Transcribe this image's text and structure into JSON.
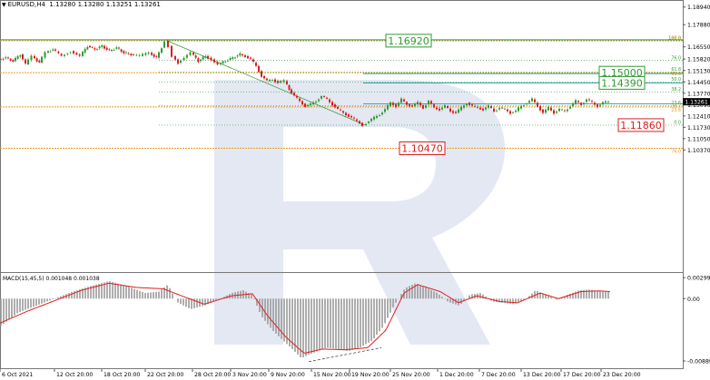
{
  "header": {
    "symbol_label": "EURUSD,H4",
    "ohlc": "1.13280 1.13280 1.13251 1.13261"
  },
  "chart_data": {
    "type": "candlestick",
    "symbol": "EURUSD",
    "timeframe": "H4",
    "price_axis": {
      "ylim": [
        1.0305,
        1.1925
      ],
      "ticks": [
        1.1894,
        1.1788,
        1.1655,
        1.1582,
        1.1513,
        1.1445,
        1.1377,
        1.1309,
        1.1241,
        1.1173,
        1.1105,
        1.1037
      ]
    },
    "current_price": "1.13261",
    "time_axis_labels": [
      "6 Oct 2021",
      "12 Oct 20:00",
      "18 Oct 20:00",
      "22 Oct 20:00",
      "28 Oct 20:00",
      "3 Nov 20:00",
      "9 Nov 20:00",
      "15 Nov 20:00",
      "19 Nov 20:00",
      "25 Nov 20:00",
      "1 Dec 20:00",
      "7 Dec 20:00",
      "13 Dec 20:00",
      "17 Dec 20:00",
      "23 Dec 20:00"
    ],
    "price_path": [
      [
        0,
        1.158
      ],
      [
        8,
        1.159
      ],
      [
        16,
        1.157
      ],
      [
        24,
        1.161
      ],
      [
        30,
        1.155
      ],
      [
        37,
        1.16
      ],
      [
        45,
        1.156
      ],
      [
        52,
        1.162
      ],
      [
        60,
        1.164
      ],
      [
        70,
        1.16
      ],
      [
        80,
        1.163
      ],
      [
        90,
        1.16
      ],
      [
        98,
        1.166
      ],
      [
        106,
        1.164
      ],
      [
        114,
        1.166
      ],
      [
        122,
        1.163
      ],
      [
        130,
        1.165
      ],
      [
        138,
        1.162
      ],
      [
        146,
        1.161
      ],
      [
        156,
        1.16
      ],
      [
        166,
        1.162
      ],
      [
        174,
        1.159
      ],
      [
        180,
        1.165
      ],
      [
        184,
        1.1692
      ],
      [
        188,
        1.166
      ],
      [
        192,
        1.16
      ],
      [
        198,
        1.156
      ],
      [
        205,
        1.159
      ],
      [
        212,
        1.162
      ],
      [
        220,
        1.157
      ],
      [
        228,
        1.16
      ],
      [
        235,
        1.158
      ],
      [
        242,
        1.155
      ],
      [
        250,
        1.157
      ],
      [
        258,
        1.159
      ],
      [
        266,
        1.161
      ],
      [
        272,
        1.16
      ],
      [
        278,
        1.158
      ],
      [
        284,
        1.154
      ],
      [
        290,
        1.148
      ],
      [
        296,
        1.145
      ],
      [
        302,
        1.146
      ],
      [
        308,
        1.144
      ],
      [
        315,
        1.145
      ],
      [
        320,
        1.14
      ],
      [
        326,
        1.136
      ],
      [
        332,
        1.133
      ],
      [
        338,
        1.13
      ],
      [
        344,
        1.131
      ],
      [
        350,
        1.133
      ],
      [
        356,
        1.136
      ],
      [
        362,
        1.134
      ],
      [
        368,
        1.131
      ],
      [
        374,
        1.128
      ],
      [
        380,
        1.126
      ],
      [
        386,
        1.124
      ],
      [
        392,
        1.122
      ],
      [
        398,
        1.12
      ],
      [
        402,
        1.1186
      ],
      [
        408,
        1.121
      ],
      [
        414,
        1.123
      ],
      [
        420,
        1.125
      ],
      [
        426,
        1.128
      ],
      [
        432,
        1.132
      ],
      [
        438,
        1.13
      ],
      [
        444,
        1.134
      ],
      [
        450,
        1.131
      ],
      [
        456,
        1.13
      ],
      [
        462,
        1.132
      ],
      [
        468,
        1.129
      ],
      [
        474,
        1.133
      ],
      [
        480,
        1.129
      ],
      [
        486,
        1.128
      ],
      [
        492,
        1.13
      ],
      [
        498,
        1.127
      ],
      [
        504,
        1.126
      ],
      [
        510,
        1.129
      ],
      [
        516,
        1.132
      ],
      [
        522,
        1.13
      ],
      [
        528,
        1.129
      ],
      [
        534,
        1.128
      ],
      [
        540,
        1.13
      ],
      [
        546,
        1.127
      ],
      [
        552,
        1.129
      ],
      [
        558,
        1.128
      ],
      [
        564,
        1.126
      ],
      [
        570,
        1.127
      ],
      [
        576,
        1.13
      ],
      [
        582,
        1.132
      ],
      [
        588,
        1.134
      ],
      [
        594,
        1.13
      ],
      [
        600,
        1.126
      ],
      [
        606,
        1.129
      ],
      [
        612,
        1.126
      ],
      [
        618,
        1.128
      ],
      [
        624,
        1.127
      ],
      [
        630,
        1.13
      ],
      [
        636,
        1.133
      ],
      [
        642,
        1.131
      ],
      [
        648,
        1.134
      ],
      [
        654,
        1.132
      ],
      [
        660,
        1.13
      ],
      [
        666,
        1.132
      ],
      [
        672,
        1.1326
      ]
    ],
    "horizontal_levels": [
      {
        "price": 1.1692,
        "color": "#e69c24"
      },
      {
        "price": 1.15,
        "color": "#e69c24"
      },
      {
        "price": 1.1295,
        "color": "#e69c24"
      },
      {
        "price": 1.1047,
        "color": "#e69c24"
      }
    ],
    "price_labels": [
      {
        "text": "1.16920",
        "price": 1.1692,
        "style": "green"
      },
      {
        "text": "1.15000",
        "price": 1.15,
        "style": "green"
      },
      {
        "text": "1.14390",
        "price": 1.1439,
        "style": "green"
      },
      {
        "text": "1.11860",
        "price": 1.1186,
        "style": "red"
      },
      {
        "text": "1.10470",
        "price": 1.1047,
        "style": "red"
      }
    ],
    "fib_retracement": {
      "levels": [
        {
          "label": "100.0",
          "price": 1.1692
        },
        {
          "label": "76.0",
          "price": 1.1573
        },
        {
          "label": "61.8",
          "price": 1.1504
        },
        {
          "label": "50.0",
          "price": 1.1443
        },
        {
          "label": "38.2",
          "price": 1.1383
        },
        {
          "label": "23.6",
          "price": 1.1303
        },
        {
          "label": "0.0",
          "price": 1.1186
        }
      ]
    },
    "fib_extension": {
      "levels": [
        {
          "label": "88.8",
          "price": 1.1692
        },
        {
          "label": "61.8",
          "price": 1.1513
        },
        {
          "label": "38.2",
          "price": 1.132
        },
        {
          "label": "23.6",
          "price": 1.1295
        },
        {
          "label": "76.0",
          "price": 1.1047
        }
      ]
    },
    "macd": {
      "label": "MACD(15,45,5) 0.001048 0.001038",
      "ylim": [
        -0.0098,
        0.0034
      ],
      "ticks": [
        0.002995,
        0.0,
        -0.008897
      ],
      "histogram": [
        [
          0,
          -0.004
        ],
        [
          20,
          -0.002
        ],
        [
          40,
          -0.001
        ],
        [
          60,
          0.0
        ],
        [
          80,
          0.001
        ],
        [
          100,
          0.0018
        ],
        [
          120,
          0.0025
        ],
        [
          140,
          0.0018
        ],
        [
          160,
          0.0008
        ],
        [
          175,
          0.001
        ],
        [
          185,
          0.002
        ],
        [
          195,
          -0.0005
        ],
        [
          210,
          -0.0015
        ],
        [
          225,
          -0.001
        ],
        [
          240,
          -0.0002
        ],
        [
          255,
          0.0008
        ],
        [
          268,
          0.0012
        ],
        [
          278,
          0.0005
        ],
        [
          288,
          -0.0025
        ],
        [
          300,
          -0.0045
        ],
        [
          312,
          -0.006
        ],
        [
          322,
          -0.0072
        ],
        [
          332,
          -0.0085
        ],
        [
          340,
          -0.008
        ],
        [
          350,
          -0.0075
        ],
        [
          360,
          -0.007
        ],
        [
          372,
          -0.0072
        ],
        [
          384,
          -0.0075
        ],
        [
          396,
          -0.007
        ],
        [
          410,
          -0.006
        ],
        [
          422,
          -0.004
        ],
        [
          434,
          -0.001
        ],
        [
          446,
          0.0015
        ],
        [
          458,
          0.0022
        ],
        [
          470,
          0.0015
        ],
        [
          482,
          0.0008
        ],
        [
          494,
          -0.0005
        ],
        [
          506,
          -0.001
        ],
        [
          518,
          0.0006
        ],
        [
          530,
          0.0008
        ],
        [
          542,
          -0.0004
        ],
        [
          554,
          -0.0006
        ],
        [
          566,
          -0.0008
        ],
        [
          578,
          -0.0002
        ],
        [
          590,
          0.0012
        ],
        [
          602,
          0.0005
        ],
        [
          614,
          -0.0002
        ],
        [
          626,
          0.0006
        ],
        [
          638,
          0.0012
        ],
        [
          650,
          0.0013
        ],
        [
          662,
          0.001
        ],
        [
          672,
          0.001
        ]
      ],
      "signal": [
        [
          0,
          -0.0035
        ],
        [
          30,
          -0.0018
        ],
        [
          60,
          -0.0003
        ],
        [
          90,
          0.0012
        ],
        [
          120,
          0.0022
        ],
        [
          150,
          0.0016
        ],
        [
          180,
          0.0014
        ],
        [
          200,
          0.0004
        ],
        [
          225,
          -0.0008
        ],
        [
          255,
          0.0004
        ],
        [
          278,
          0.0007
        ],
        [
          295,
          -0.0025
        ],
        [
          315,
          -0.0055
        ],
        [
          335,
          -0.0078
        ],
        [
          355,
          -0.0072
        ],
        [
          380,
          -0.0073
        ],
        [
          405,
          -0.007
        ],
        [
          425,
          -0.0045
        ],
        [
          445,
          0.0008
        ],
        [
          460,
          0.002
        ],
        [
          485,
          0.001
        ],
        [
          505,
          -0.0006
        ],
        [
          525,
          0.0004
        ],
        [
          550,
          -0.0004
        ],
        [
          570,
          -0.0006
        ],
        [
          595,
          0.0008
        ],
        [
          615,
          0.0
        ],
        [
          640,
          0.001
        ],
        [
          660,
          0.0011
        ],
        [
          672,
          0.001
        ]
      ]
    }
  }
}
